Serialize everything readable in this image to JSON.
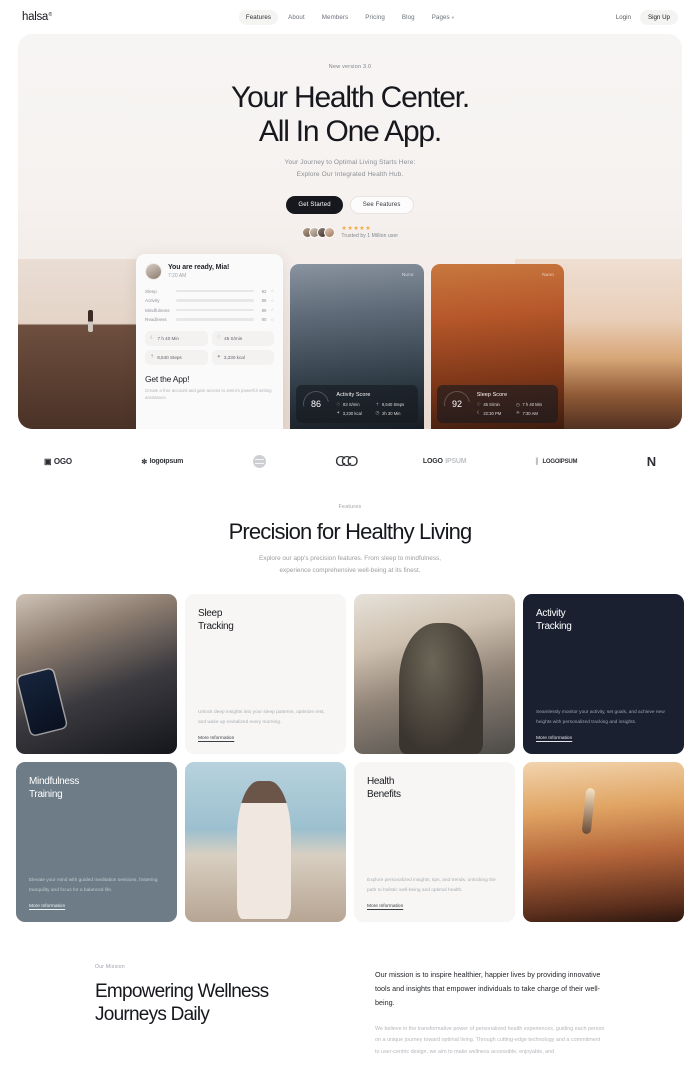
{
  "nav": {
    "brand": "halsa",
    "brand_mark": "®",
    "links": [
      {
        "label": "Features",
        "active": true
      },
      {
        "label": "About",
        "active": false
      },
      {
        "label": "Members",
        "active": false
      },
      {
        "label": "Pricing",
        "active": false
      },
      {
        "label": "Blog",
        "active": false
      },
      {
        "label": "Pages",
        "active": false,
        "caret": "▾"
      }
    ],
    "login": "Login",
    "signup": "Sign Up"
  },
  "hero": {
    "badge": "New version 3.0",
    "title_line1": "Your Health Center.",
    "title_line2": "All In One App.",
    "sub_line1": "Your Journey to Optimal Living Starts Here:",
    "sub_line2": "Explore Our Integrated Health Hub.",
    "cta_primary": "Get Started",
    "cta_secondary": "See Features",
    "stars": "★★★★★",
    "trust_label": "Trusted by 1 Million user"
  },
  "dashboard": {
    "greeting": "You are ready, Mia!",
    "time": "7:20 AM",
    "metrics": [
      {
        "name": "Sleep",
        "value": "92",
        "pct": 92
      },
      {
        "name": "Activity",
        "value": "88",
        "pct": 80
      },
      {
        "name": "Mindfulness",
        "value": "89",
        "pct": 72
      },
      {
        "name": "Readiness",
        "value": "90",
        "pct": 86
      }
    ],
    "star": "☆",
    "chips": [
      {
        "icon": "moon-icon",
        "glyph": "☾",
        "label": "7 h 40 Min"
      },
      {
        "icon": "heart-icon",
        "glyph": "♡",
        "label": "45 S/min"
      },
      {
        "icon": "steps-icon",
        "glyph": "⇡",
        "label": "8,540 Steps"
      },
      {
        "icon": "flame-icon",
        "glyph": "✦",
        "label": "3,230 kcal"
      }
    ],
    "footer_title": "Get the App!",
    "footer_text": "Create a free account and gain access to Jenni's powerful writing assistance."
  },
  "score_cards": [
    {
      "watermark": "Nuno",
      "score": "86",
      "title": "Activity Score",
      "items": [
        {
          "glyph": "♡",
          "label": "83 S/min"
        },
        {
          "glyph": "⇡",
          "label": "8,540 Steps"
        },
        {
          "glyph": "✦",
          "label": "3,230 kcal"
        },
        {
          "glyph": "◷",
          "label": "2h 30 Min"
        }
      ]
    },
    {
      "watermark": "Nuno",
      "score": "92",
      "title": "Sleep Score",
      "items": [
        {
          "glyph": "♡",
          "label": "45 S/min"
        },
        {
          "glyph": "◷",
          "label": "7 h 40 Min"
        },
        {
          "glyph": "☾",
          "label": "22:30 PM"
        },
        {
          "glyph": "☀",
          "label": "7:30 AM"
        }
      ]
    }
  ],
  "logos": [
    {
      "name": "logo-boxed-logo",
      "text": "OGO",
      "prefix": "▣"
    },
    {
      "name": "logo-logoipsum-star",
      "text": "logoipsum",
      "prefix": "✼"
    },
    {
      "name": "logo-circle-mark",
      "text": "",
      "prefix": ""
    },
    {
      "name": "logo-triple-o",
      "text": "CCO",
      "prefix": ""
    },
    {
      "name": "logo-logo-ipsum-bold",
      "text": "LOGO",
      "suffix": "IPSUM"
    },
    {
      "name": "logo-flag-ipsum",
      "text": "LOGOIPSUM",
      "prefix": "▌"
    },
    {
      "name": "logo-n-mark",
      "text": "N",
      "prefix": ""
    }
  ],
  "features": {
    "eyebrow": "Features",
    "title": "Precision for Healthy Living",
    "sub_line1": "Explore our app's precision features. From sleep to mindfulness,",
    "sub_line2": "experience comprehensive well-being at its finest.",
    "cards": [
      {
        "kind": "image",
        "image": "woman-sleeping-with-phone",
        "title": "",
        "body": "",
        "link": ""
      },
      {
        "kind": "light",
        "title_line1": "Sleep",
        "title_line2": "Tracking",
        "body": "Unlock deep insights into your sleep patterns, optimize rest, and wake up revitalized every morning.",
        "link": "More Information"
      },
      {
        "kind": "image",
        "image": "bearded-man-outdoors",
        "title": "",
        "body": "",
        "link": ""
      },
      {
        "kind": "dark",
        "title_line1": "Activity",
        "title_line2": "Tracking",
        "body": "Seamlessly monitor your activity, set goals, and achieve new heights with personalized tracking and insights.",
        "link": "More Information"
      },
      {
        "kind": "slate",
        "title_line1": "Mindfulness",
        "title_line2": "Training",
        "body": "Elevate your mind with guided meditation sessions, fostering tranquility and focus for a balanced life.",
        "link": "More Information"
      },
      {
        "kind": "image",
        "image": "woman-at-beach",
        "title": "",
        "body": "",
        "link": ""
      },
      {
        "kind": "light",
        "title_line1": "Health",
        "title_line2": "Benefits",
        "body": "Explore personalized insights, tips, and trends, unlocking the path to holistic well-being and optimal health.",
        "link": "More Information"
      },
      {
        "kind": "image",
        "image": "yoga-handstand-sunset",
        "title": "",
        "body": "",
        "link": ""
      }
    ]
  },
  "mission": {
    "eyebrow": "Our Mission",
    "title_line1": "Empowering Wellness",
    "title_line2": "Journeys Daily",
    "lead": "Our mission is to inspire healthier, happier lives by providing innovative tools and insights that empower individuals to take charge of their well-being.",
    "body": "We believe in the transformative power of personalized health experiences, guiding each person on a unique journey toward optimal living. Through cutting-edge technology and a commitment to user-centric design, we aim to make wellness accessible, enjoyable, and"
  },
  "colors": {
    "ink": "#16181d",
    "muted": "#9d9da2",
    "dark_card": "#1a2030",
    "slate_card": "#6d7c86",
    "light_card": "#f7f6f5",
    "star": "#f2a93b"
  }
}
